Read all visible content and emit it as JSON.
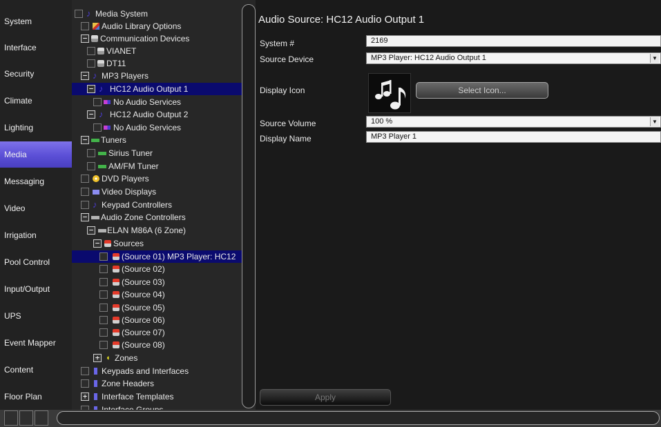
{
  "nav": {
    "items": [
      {
        "label": "System",
        "active": false
      },
      {
        "label": "Interface",
        "active": false
      },
      {
        "label": "Security",
        "active": false
      },
      {
        "label": "Climate",
        "active": false
      },
      {
        "label": "Lighting",
        "active": false
      },
      {
        "label": "Media",
        "active": true
      },
      {
        "label": "Messaging",
        "active": false
      },
      {
        "label": "Video",
        "active": false
      },
      {
        "label": "Irrigation",
        "active": false
      },
      {
        "label": "Pool Control",
        "active": false
      },
      {
        "label": "Input/Output",
        "active": false
      },
      {
        "label": "UPS",
        "active": false
      },
      {
        "label": "Event Mapper",
        "active": false
      },
      {
        "label": "Content",
        "active": false
      },
      {
        "label": "Floor Plan",
        "active": false
      }
    ]
  },
  "tree": {
    "items": [
      {
        "label": "Media System",
        "icon": "music-note-icon"
      },
      {
        "label": "Audio Library Options",
        "icon": "audio-library-icon"
      },
      {
        "label": "Communication Devices",
        "icon": "communication-device-icon"
      },
      {
        "label": "VIANET",
        "icon": "communication-device-icon"
      },
      {
        "label": "DT11",
        "icon": "communication-device-icon"
      },
      {
        "label": "MP3 Players",
        "icon": "music-note-icon"
      },
      {
        "label": "HC12 Audio Output 1",
        "icon": "music-note-icon",
        "selected": true
      },
      {
        "label": "No Audio Services",
        "icon": "no-audio-services-icon"
      },
      {
        "label": "HC12 Audio Output 2",
        "icon": "music-note-icon"
      },
      {
        "label": "No Audio Services",
        "icon": "no-audio-services-icon"
      },
      {
        "label": "Tuners",
        "icon": "tuner-icon"
      },
      {
        "label": "Sirius Tuner",
        "icon": "tuner-icon"
      },
      {
        "label": "AM/FM Tuner",
        "icon": "tuner-icon"
      },
      {
        "label": "DVD Players",
        "icon": "dvd-icon"
      },
      {
        "label": "Video Displays",
        "icon": "video-display-icon"
      },
      {
        "label": "Keypad Controllers",
        "icon": "music-note-icon"
      },
      {
        "label": "Audio Zone Controllers",
        "icon": "zone-controller-icon"
      },
      {
        "label": "ELAN M86A (6 Zone)",
        "icon": "zone-controller-icon"
      },
      {
        "label": "Sources",
        "icon": "source-icon"
      },
      {
        "label": "(Source 01) MP3 Player: HC12",
        "icon": "source-icon",
        "selected": true
      },
      {
        "label": "(Source 02)",
        "icon": "source-icon"
      },
      {
        "label": "(Source 03)",
        "icon": "source-icon"
      },
      {
        "label": "(Source 04)",
        "icon": "source-icon"
      },
      {
        "label": "(Source 05)",
        "icon": "source-icon"
      },
      {
        "label": "(Source 06)",
        "icon": "source-icon"
      },
      {
        "label": "(Source 07)",
        "icon": "source-icon"
      },
      {
        "label": "(Source 08)",
        "icon": "source-icon"
      },
      {
        "label": "Zones",
        "icon": "speaker-icon"
      },
      {
        "label": "Keypads and Interfaces",
        "icon": "keypad-icon"
      },
      {
        "label": "Zone Headers",
        "icon": "keypad-icon"
      },
      {
        "label": "Interface Templates",
        "icon": "keypad-icon"
      },
      {
        "label": "Interface Groups",
        "icon": "keypad-icon"
      }
    ]
  },
  "detail": {
    "title": "Audio Source: HC12 Audio Output 1",
    "system_label": "System #",
    "system_value": "2169",
    "source_device_label": "Source Device",
    "source_device_value": "MP3 Player: HC12 Audio Output 1",
    "display_icon_label": "Display Icon",
    "display_icon": "music-notes-icon",
    "select_icon_label": "Select Icon...",
    "source_volume_label": "Source Volume",
    "source_volume_value": "100 %",
    "display_name_label": "Display Name",
    "display_name_value": "MP3 Player 1",
    "apply_label": "Apply"
  },
  "colors": {
    "nav_active": "#5b4fd6",
    "tree_selected": "#0a0a6e",
    "background": "#1a1a1a"
  }
}
